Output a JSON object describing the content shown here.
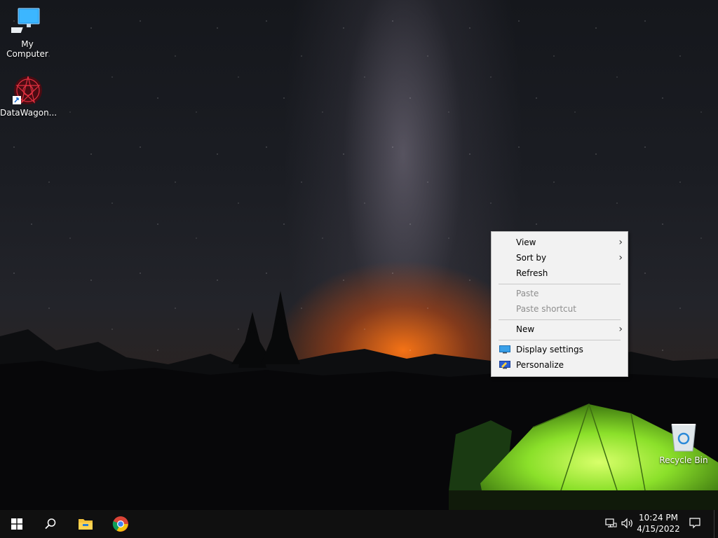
{
  "desktop": {
    "icons": [
      {
        "label": "My Computer"
      },
      {
        "label": "DataWagon..."
      },
      {
        "label": "Recycle Bin"
      }
    ]
  },
  "context_menu": {
    "items": [
      {
        "label": "View",
        "submenu": true,
        "enabled": true
      },
      {
        "label": "Sort by",
        "submenu": true,
        "enabled": true
      },
      {
        "label": "Refresh",
        "submenu": false,
        "enabled": true
      },
      {
        "label": "Paste",
        "submenu": false,
        "enabled": false
      },
      {
        "label": "Paste shortcut",
        "submenu": false,
        "enabled": false
      },
      {
        "label": "New",
        "submenu": true,
        "enabled": true
      },
      {
        "label": "Display settings",
        "icon": "monitor-icon",
        "submenu": false,
        "enabled": true
      },
      {
        "label": "Personalize",
        "icon": "personalize-icon",
        "submenu": false,
        "enabled": true
      }
    ],
    "chevron": "›"
  },
  "taskbar": {
    "time": "10:24 PM",
    "date": "4/15/2022",
    "apps": [
      "start-icon",
      "search-icon",
      "file-explorer-icon",
      "chrome-icon"
    ],
    "tray": [
      "network-icon",
      "volume-icon",
      "notification-icon"
    ]
  },
  "colors": {
    "taskbar_bg": "#101010",
    "menu_bg": "#f2f2f2",
    "windows_blue": "#1e90ff",
    "tent_green": "#8be02a",
    "horizon_orange": "#ff7614"
  }
}
